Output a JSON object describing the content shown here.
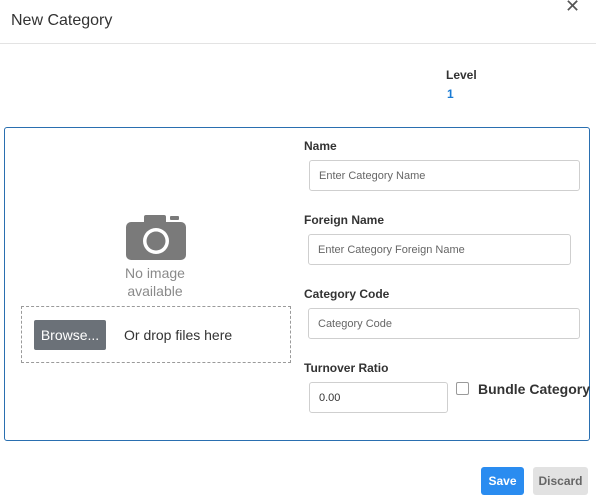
{
  "dialog": {
    "title": "New Category",
    "close_icon": "close-icon"
  },
  "level": {
    "label": "Level",
    "value": "1"
  },
  "image": {
    "icon": "camera-icon",
    "placeholder_line1": "No image",
    "placeholder_line2": "available",
    "browse_label": "Browse...",
    "drop_text": "Or drop files here"
  },
  "form": {
    "name": {
      "label": "Name",
      "placeholder": "Enter Category Name",
      "value": ""
    },
    "foreign_name": {
      "label": "Foreign Name",
      "placeholder": "Enter Category Foreign Name",
      "value": ""
    },
    "category_code": {
      "label": "Category Code",
      "placeholder": "Category Code",
      "value": ""
    },
    "turnover_ratio": {
      "label": "Turnover Ratio",
      "value": "0.00"
    },
    "bundle_category": {
      "label": "Bundle Category",
      "checked": false
    }
  },
  "footer": {
    "save_label": "Save",
    "discard_label": "Discard"
  },
  "colors": {
    "accent": "#2a8cf0",
    "level_value": "#1a7bd4",
    "card_border": "#2a6fb0",
    "browse_bg": "#6b7178"
  }
}
